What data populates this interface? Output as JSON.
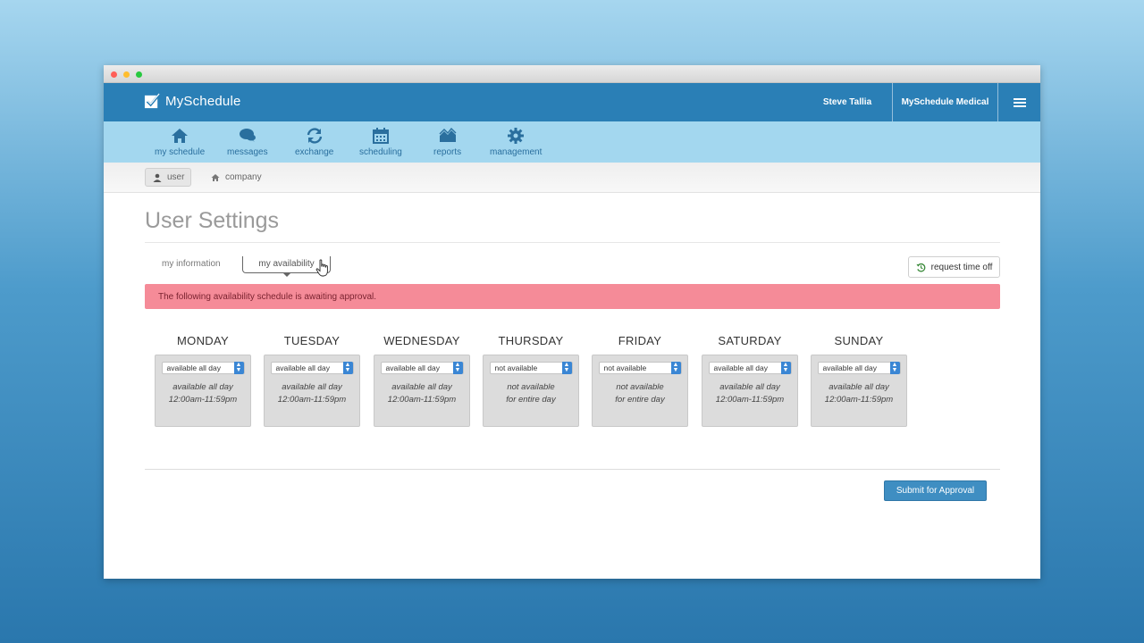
{
  "app": {
    "name": "MySchedule",
    "user_name": "Steve Tallia",
    "org_name": "MySchedule Medical"
  },
  "nav": [
    {
      "label": "my schedule",
      "icon": "home-icon"
    },
    {
      "label": "messages",
      "icon": "chat-icon"
    },
    {
      "label": "exchange",
      "icon": "exchange-icon"
    },
    {
      "label": "scheduling",
      "icon": "calendar-icon"
    },
    {
      "label": "reports",
      "icon": "chart-icon"
    },
    {
      "label": "management",
      "icon": "gear-icon"
    }
  ],
  "subnav": {
    "user_label": "user",
    "company_label": "company"
  },
  "page": {
    "title": "User Settings",
    "tab_info": "my information",
    "tab_availability": "my availability",
    "request_time_off": "request time off",
    "alert": "The following availability schedule is awaiting approval.",
    "submit": "Submit for Approval"
  },
  "days": [
    {
      "name": "MONDAY",
      "selected": "available all day",
      "line1": "available all day",
      "line2": "12:00am-11:59pm"
    },
    {
      "name": "TUESDAY",
      "selected": "available all day",
      "line1": "available all day",
      "line2": "12:00am-11:59pm"
    },
    {
      "name": "WEDNESDAY",
      "selected": "available all day",
      "line1": "available all day",
      "line2": "12:00am-11:59pm"
    },
    {
      "name": "THURSDAY",
      "selected": "not available",
      "line1": "not available",
      "line2": "for entire day"
    },
    {
      "name": "FRIDAY",
      "selected": "not available",
      "line1": "not available",
      "line2": "for entire day"
    },
    {
      "name": "SATURDAY",
      "selected": "available all day",
      "line1": "available all day",
      "line2": "12:00am-11:59pm"
    },
    {
      "name": "SUNDAY",
      "selected": "available all day",
      "line1": "available all day",
      "line2": "12:00am-11:59pm"
    }
  ],
  "colors": {
    "primary": "#2a7fb6",
    "nav_bg": "#a3d7ef",
    "alert_bg": "#f58b98",
    "submit_bg": "#3f8ec2"
  }
}
